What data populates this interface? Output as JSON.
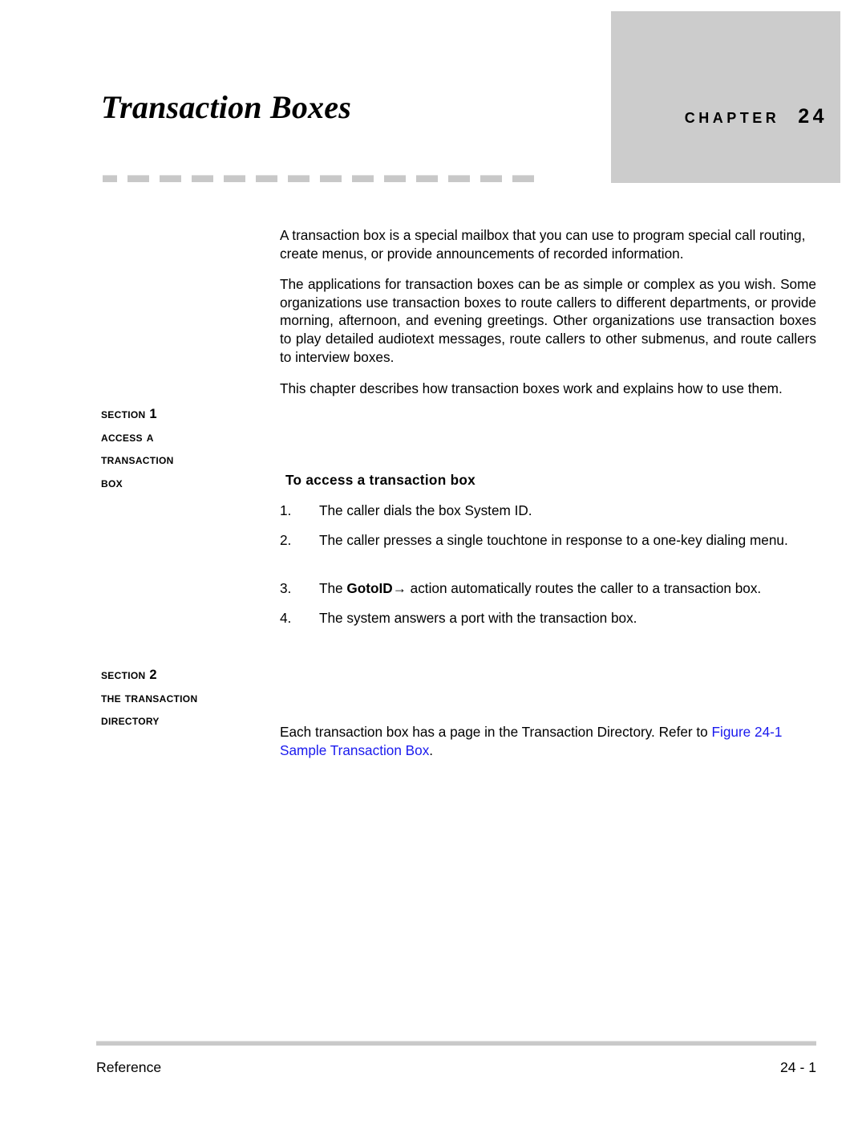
{
  "header": {
    "chapter_label": "Chapter",
    "chapter_number": "24",
    "title": "Transaction Boxes",
    "badge_color": "#cccccc"
  },
  "intro": {
    "paragraph_1": "A transaction box is a special mailbox that you can use to program special call routing, create menus, or provide announcements of recorded information.",
    "paragraph_2": "The applications for transaction boxes can be as simple or complex as you wish. Some organizations use transaction boxes to route callers to different departments, or provide morning, afternoon, and evening greetings. Other organizations use transaction boxes to play detailed audiotext messages, route callers to other submenus, and route callers to interview boxes.",
    "paragraph_3": "This chapter describes how transaction boxes work and explains how to use them."
  },
  "sections": [
    {
      "label": "Section",
      "number": "1",
      "title_line_1": "Access a",
      "title_line_2": "Transaction",
      "title_line_3": "Box"
    },
    {
      "label": "Section",
      "number": "2",
      "title_line_1": "The Transaction",
      "title_line_2": "Directory"
    }
  ],
  "section_1_body": {
    "heading": "To access a transaction box",
    "steps": [
      {
        "marker": "1.",
        "text": "The caller dials the box System ID."
      },
      {
        "marker": "2.",
        "text": "The caller presses a single touchtone in response to a one-key dialing menu."
      },
      {
        "marker": "3.",
        "prefix": "The ",
        "bold_term": "GotoID",
        "arrow_glyph": "→",
        "suffix": " action automatically routes the caller to a transaction box."
      },
      {
        "marker": "4.",
        "text": "The system answers a port with the transaction box."
      }
    ]
  },
  "section_2_body": {
    "text_before_link": "Each transaction box has a page in the Transaction Directory. Refer to ",
    "link_text": "Figure 24-1 Sample Transaction Box",
    "text_after_link": ".",
    "link_color": "#1a1aee"
  },
  "footer": {
    "left": "Reference",
    "page_number": "24 - 1"
  }
}
